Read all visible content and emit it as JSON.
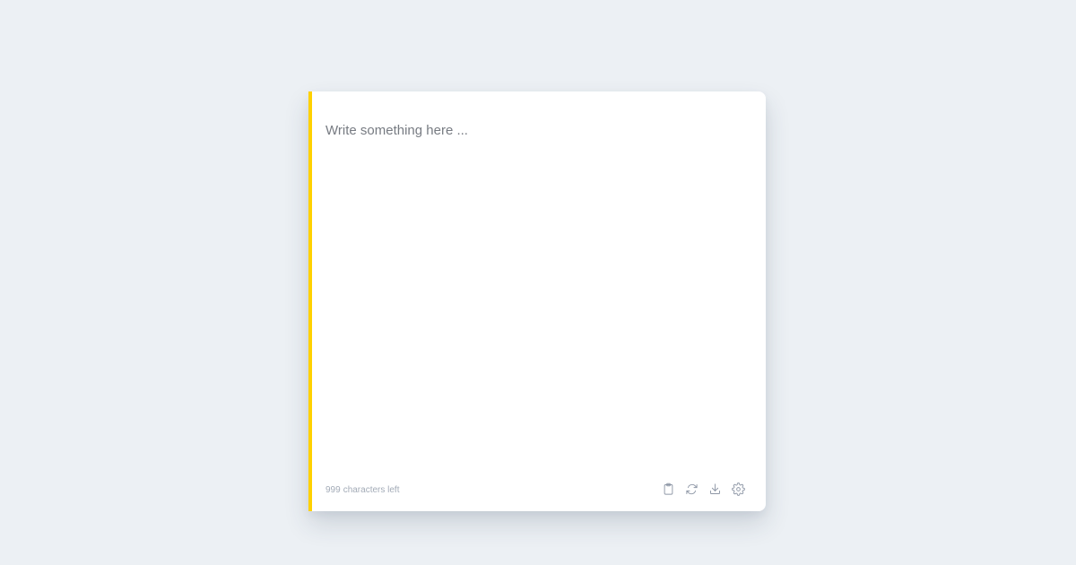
{
  "editor": {
    "placeholder": "Write something here ...",
    "value": "",
    "accent_color": "#ffd100"
  },
  "footer": {
    "chars_left": "999",
    "chars_left_suffix": "characters left",
    "actions": [
      {
        "icon": "clipboard-icon",
        "label": "copy"
      },
      {
        "icon": "refresh-icon",
        "label": "reset"
      },
      {
        "icon": "download-icon",
        "label": "download"
      },
      {
        "icon": "gear-icon",
        "label": "settings"
      }
    ]
  },
  "colors": {
    "page_background": "#ecf0f4",
    "card_background": "#ffffff",
    "icon_color": "#8e97a6",
    "counter_color": "#a3abb7"
  }
}
